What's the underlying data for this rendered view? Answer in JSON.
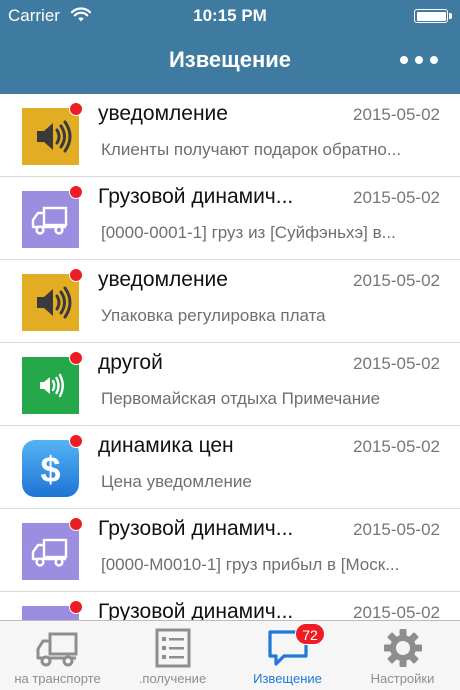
{
  "status_bar": {
    "carrier": "Carrier",
    "time": "10:15 PM"
  },
  "nav": {
    "title": "Извещение"
  },
  "notifications": [
    {
      "icon": "speaker-icon",
      "icon_bg": "#e3ad23",
      "unread": true,
      "title": "уведомление",
      "date": "2015-05-02",
      "subtitle": "Клиенты получают подарок обратно..."
    },
    {
      "icon": "truck-icon",
      "icon_bg": "#9b8de0",
      "unread": true,
      "title": "Грузовой динамич...",
      "date": "2015-05-02",
      "subtitle": "[0000-0001-1] груз из [Суйфэньхэ] в..."
    },
    {
      "icon": "speaker-icon",
      "icon_bg": "#e3ad23",
      "unread": true,
      "title": "уведомление",
      "date": "2015-05-02",
      "subtitle": "Упаковка регулировка плата"
    },
    {
      "icon": "speaker-small-icon",
      "icon_bg": "#24a84a",
      "unread": true,
      "title": "другой",
      "date": "2015-05-02",
      "subtitle": "Первомайская отдыха Примечание"
    },
    {
      "icon": "dollar-icon",
      "icon_bg": "#2f8fe0",
      "unread": true,
      "title": "динамика цен",
      "date": "2015-05-02",
      "subtitle": "Цена уведомление"
    },
    {
      "icon": "truck-icon",
      "icon_bg": "#9b8de0",
      "unread": true,
      "title": "Грузовой динамич...",
      "date": "2015-05-02",
      "subtitle": "[0000-M0010-1] груз прибыл в [Моск..."
    },
    {
      "icon": "truck-icon",
      "icon_bg": "#9b8de0",
      "unread": true,
      "title": "Грузовой динамич...",
      "date": "2015-05-02",
      "subtitle": ""
    }
  ],
  "tabs": [
    {
      "label": "на транспорте",
      "icon": "truck-tab-icon",
      "active": false
    },
    {
      "label": ".получение",
      "icon": "list-tab-icon",
      "active": false
    },
    {
      "label": "Извещение",
      "icon": "chat-tab-icon",
      "active": true,
      "badge": "72"
    },
    {
      "label": "Настройки",
      "icon": "gear-tab-icon",
      "active": false
    }
  ],
  "colors": {
    "header": "#3f7aa0",
    "accent": "#1f79d5",
    "badge": "#ee1c24"
  }
}
